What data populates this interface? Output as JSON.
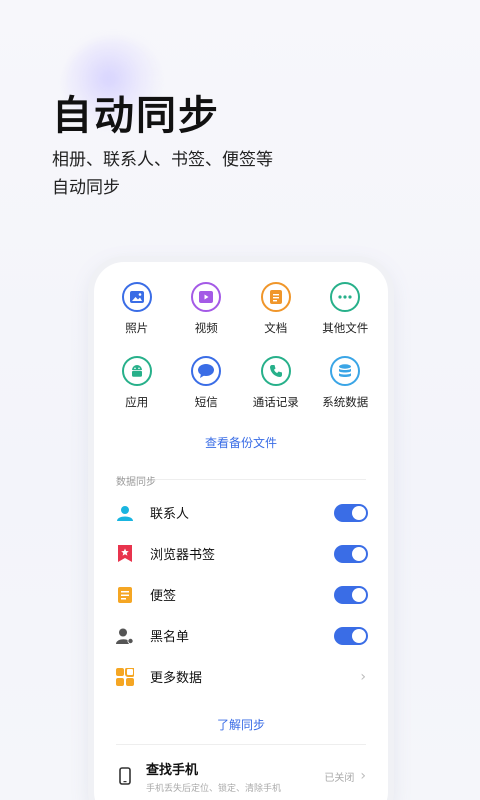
{
  "hero": {
    "title": "自动同步",
    "subtitle_line1": "相册、联系人、书签、便签等",
    "subtitle_line2": "自动同步"
  },
  "categories": [
    {
      "label": "照片",
      "icon": "photo-icon",
      "color": "#3a6de6"
    },
    {
      "label": "视频",
      "icon": "video-icon",
      "color": "#a45ae6"
    },
    {
      "label": "文档",
      "icon": "document-icon",
      "color": "#f0962a"
    },
    {
      "label": "其他文件",
      "icon": "more-files-icon",
      "color": "#27b08a"
    },
    {
      "label": "应用",
      "icon": "android-app-icon",
      "color": "#27b08a"
    },
    {
      "label": "短信",
      "icon": "message-icon",
      "color": "#3a6de6"
    },
    {
      "label": "通话记录",
      "icon": "phone-call-icon",
      "color": "#27b08a"
    },
    {
      "label": "系统数据",
      "icon": "database-icon",
      "color": "#3aa5e6"
    }
  ],
  "view_backup_label": "查看备份文件",
  "sync_section_title": "数据同步",
  "sync_items": [
    {
      "label": "联系人",
      "icon": "contact-icon",
      "enabled": true
    },
    {
      "label": "浏览器书签",
      "icon": "bookmark-icon",
      "enabled": true
    },
    {
      "label": "便签",
      "icon": "note-icon",
      "enabled": true
    },
    {
      "label": "黑名单",
      "icon": "blocklist-icon",
      "enabled": true
    },
    {
      "label": "更多数据",
      "icon": "more-data-icon"
    }
  ],
  "learn_sync_label": "了解同步",
  "find_phone": {
    "title": "查找手机",
    "subtitle": "手机丢失后定位、锁定、清除手机",
    "status": "已关闭"
  },
  "colors": {
    "accent": "#3a6de6",
    "toggle_on": "#3a6de6"
  }
}
